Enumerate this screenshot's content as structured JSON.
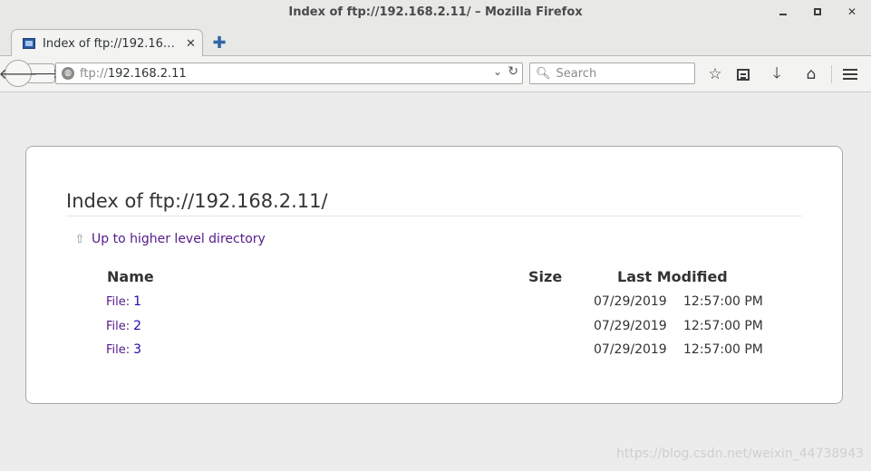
{
  "window": {
    "title": "Index of ftp://192.168.2.11/ – Mozilla Firefox"
  },
  "tab": {
    "label": "Index of ftp://192.16…",
    "close": "✕",
    "new_tab": "✚"
  },
  "navbar": {
    "url_scheme": "ftp://",
    "url_host": "192.168.2.11",
    "search_placeholder": "Search"
  },
  "page": {
    "heading": "Index of ftp://192.168.2.11/",
    "up_link": "Up to higher level directory",
    "columns": {
      "name": "Name",
      "size": "Size",
      "last_modified": "Last Modified"
    },
    "files": [
      {
        "prefix": "File:",
        "name": "1",
        "size": "",
        "date": "07/29/2019",
        "time": "12:57:00 PM"
      },
      {
        "prefix": "File:",
        "name": "2",
        "size": "",
        "date": "07/29/2019",
        "time": "12:57:00 PM"
      },
      {
        "prefix": "File:",
        "name": "3",
        "size": "",
        "date": "07/29/2019",
        "time": "12:57:00 PM"
      }
    ]
  },
  "watermark": "https://blog.csdn.net/weixin_44738943"
}
